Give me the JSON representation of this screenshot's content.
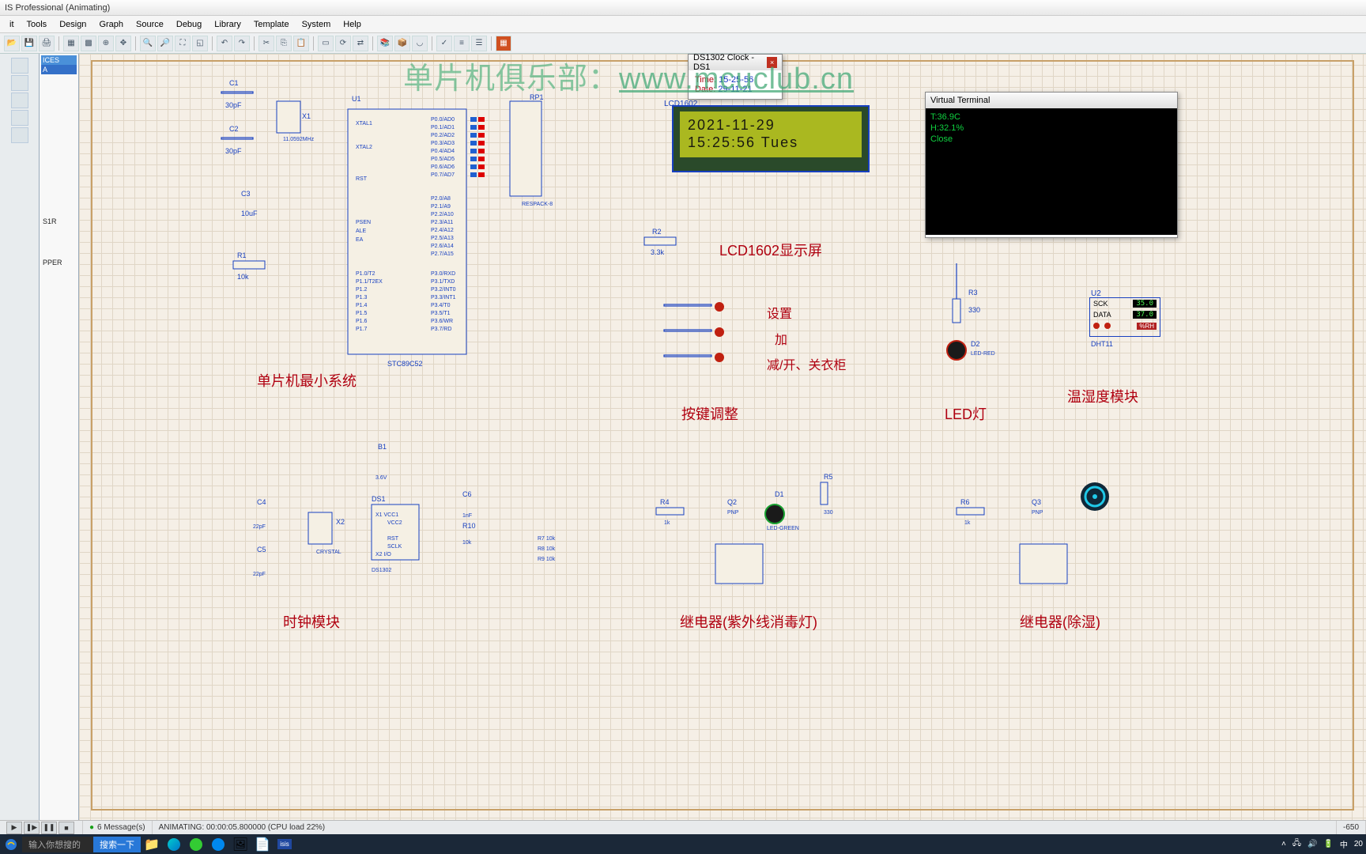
{
  "window": {
    "title": "IS Professional (Animating)"
  },
  "menu": [
    "it",
    "Tools",
    "Design",
    "Graph",
    "Source",
    "Debug",
    "Library",
    "Template",
    "System",
    "Help"
  ],
  "devicelist": {
    "header": "ICES",
    "selected": "A",
    "items": [
      "S1R",
      "PPER"
    ]
  },
  "watermark": {
    "text": "单片机俱乐部：",
    "url": "www.mcuclub.cn"
  },
  "lcd": {
    "ref": "LCD1602",
    "line1": "2021-11-29",
    "line2": " 15:25:56 Tues"
  },
  "ds1302win": {
    "title": "DS1302 Clock - DS1",
    "time_k": "Time:",
    "time_v": "15-25-56",
    "date_k": "Date:",
    "date_v": "29-11-21"
  },
  "vterm": {
    "title": "Virtual Terminal",
    "lines": [
      "T:36.9C",
      "H:32.1%",
      "Close"
    ]
  },
  "mcu": {
    "ref": "U1",
    "part": "STC89C52",
    "xtal": {
      "ref": "X1",
      "val": "11.0592MHz"
    },
    "c1": {
      "ref": "C1",
      "val": "30pF"
    },
    "c2": {
      "ref": "C2",
      "val": "30pF"
    },
    "c3": {
      "ref": "C3",
      "val": "10uF"
    },
    "r1": {
      "ref": "R1",
      "val": "10k"
    },
    "rp1": {
      "ref": "RP1",
      "part": "RESPACK-8"
    }
  },
  "lcd_r": {
    "ref": "R2",
    "val": "3.3k"
  },
  "led_mod": {
    "r": {
      "ref": "R3",
      "val": "330"
    },
    "d": {
      "ref": "D2",
      "part": "LED-RED"
    }
  },
  "dht": {
    "ref": "U2",
    "part": "DHT11",
    "sck": "SCK",
    "data": "DATA",
    "t": "35.0",
    "h": "37.0",
    "rh": "%RH"
  },
  "clock_mod": {
    "b1": "B1",
    "b1v": "3.6V",
    "c4": {
      "ref": "C4",
      "val": "22pF"
    },
    "c5": {
      "ref": "C5",
      "val": "22pF"
    },
    "x2": {
      "ref": "X2",
      "part": "CRYSTAL"
    },
    "ds1": {
      "ref": "DS1",
      "part": "DS1302"
    },
    "c6": {
      "ref": "C6",
      "val": "1nF"
    },
    "r10": {
      "ref": "R10",
      "val": "10k"
    },
    "r7": "R7  10k",
    "r8": "R8  10k",
    "r9": "R9  10k"
  },
  "relay1": {
    "r4": {
      "ref": "R4",
      "val": "1k"
    },
    "q": {
      "ref": "Q2",
      "part": "PNP"
    },
    "d": {
      "ref": "D1",
      "part": "LED-GREEN"
    },
    "r5": {
      "ref": "R5",
      "val": "330"
    }
  },
  "relay2": {
    "r6": {
      "ref": "R6",
      "val": "1k"
    },
    "q": {
      "ref": "Q3",
      "part": "PNP"
    }
  },
  "labels": {
    "mcu": "单片机最小系统",
    "lcd": "LCD1602显示屏",
    "keys": "按键调整",
    "set": "设置",
    "add": "加",
    "sub": "减/开、关衣柜",
    "led": "LED灯",
    "dht": "温湿度模块",
    "clock": "时钟模块",
    "relay1": "继电器(紫外线消毒灯)",
    "relay2": "继电器(除湿)"
  },
  "status": {
    "msgs": "6 Message(s)",
    "anim": "ANIMATING: 00:00:05.800000 (CPU load 22%)",
    "coord": "-650"
  },
  "taskbar": {
    "search": "输入你想搜的",
    "searchbtn": "搜索一下",
    "ime": "中",
    "time": "20"
  }
}
